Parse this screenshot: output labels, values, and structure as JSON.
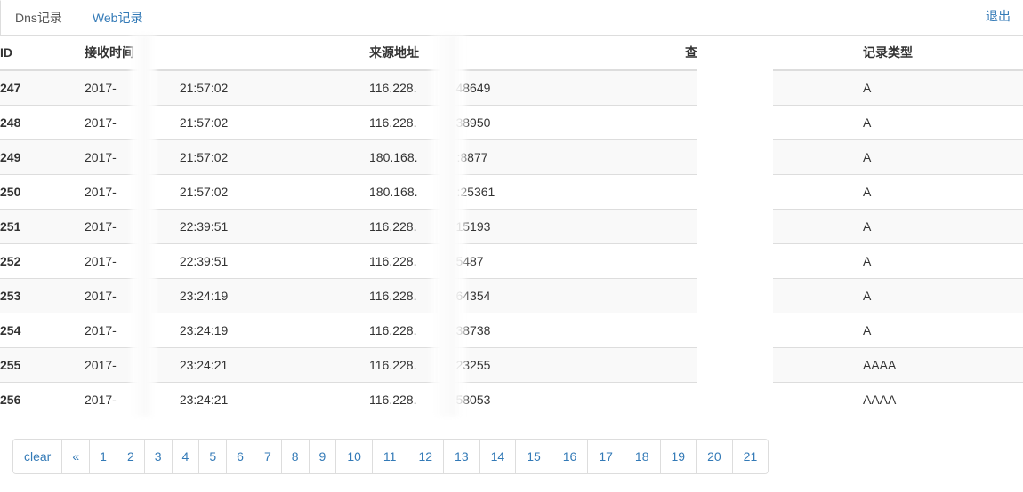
{
  "header": {
    "tabs": [
      {
        "label": "Dns记录",
        "active": true,
        "name": "tab-dns-records"
      },
      {
        "label": "Web记录",
        "active": false,
        "name": "tab-web-records"
      }
    ],
    "logout_label": "退出"
  },
  "table": {
    "columns": [
      {
        "key": "id",
        "label": "ID"
      },
      {
        "key": "time",
        "label": "接收时间"
      },
      {
        "key": "src",
        "label": "来源地址"
      },
      {
        "key": "host",
        "label": "查询主机"
      },
      {
        "key": "type",
        "label": "记录类型"
      }
    ],
    "rows": [
      {
        "id": "247",
        "date": "2017-",
        "time": "21:57:02",
        "ip": "116.228.",
        "port": "48649",
        "host": "",
        "type": "A"
      },
      {
        "id": "248",
        "date": "2017-",
        "time": "21:57:02",
        "ip": "116.228.",
        "port": "38950",
        "host": "",
        "type": "A"
      },
      {
        "id": "249",
        "date": "2017-",
        "time": "21:57:02",
        "ip": "180.168.",
        "port": ":8877",
        "host": "",
        "type": "A"
      },
      {
        "id": "250",
        "date": "2017-",
        "time": "21:57:02",
        "ip": "180.168.",
        "port": ":25361",
        "host": "",
        "type": "A"
      },
      {
        "id": "251",
        "date": "2017-",
        "time": "22:39:51",
        "ip": "116.228.",
        "port": "15193",
        "host": "",
        "type": "A"
      },
      {
        "id": "252",
        "date": "2017-",
        "time": "22:39:51",
        "ip": "116.228.",
        "port": "5487",
        "host": "",
        "type": "A"
      },
      {
        "id": "253",
        "date": "2017-",
        "time": "23:24:19",
        "ip": "116.228.",
        "port": "64354",
        "host": "",
        "type": "A"
      },
      {
        "id": "254",
        "date": "2017-",
        "time": "23:24:19",
        "ip": "116.228.",
        "port": "38738",
        "host": "",
        "type": "A"
      },
      {
        "id": "255",
        "date": "2017-",
        "time": "23:24:21",
        "ip": "116.228.",
        "port": "23255",
        "host": "",
        "type": "AAAA"
      },
      {
        "id": "256",
        "date": "2017-",
        "time": "23:24:21",
        "ip": "116.228.",
        "port": "58053",
        "host": "",
        "type": "AAAA"
      }
    ]
  },
  "pagination": {
    "items": [
      {
        "label": "clear",
        "name": "pagination-clear"
      },
      {
        "label": "«",
        "name": "pagination-prev"
      },
      {
        "label": "1",
        "name": "pagination-page-1"
      },
      {
        "label": "2",
        "name": "pagination-page-2"
      },
      {
        "label": "3",
        "name": "pagination-page-3"
      },
      {
        "label": "4",
        "name": "pagination-page-4"
      },
      {
        "label": "5",
        "name": "pagination-page-5"
      },
      {
        "label": "6",
        "name": "pagination-page-6"
      },
      {
        "label": "7",
        "name": "pagination-page-7"
      },
      {
        "label": "8",
        "name": "pagination-page-8"
      },
      {
        "label": "9",
        "name": "pagination-page-9"
      },
      {
        "label": "10",
        "name": "pagination-page-10"
      },
      {
        "label": "11",
        "name": "pagination-page-11"
      },
      {
        "label": "12",
        "name": "pagination-page-12"
      },
      {
        "label": "13",
        "name": "pagination-page-13"
      },
      {
        "label": "14",
        "name": "pagination-page-14"
      },
      {
        "label": "15",
        "name": "pagination-page-15"
      },
      {
        "label": "16",
        "name": "pagination-page-16"
      },
      {
        "label": "17",
        "name": "pagination-page-17"
      },
      {
        "label": "18",
        "name": "pagination-page-18"
      },
      {
        "label": "19",
        "name": "pagination-page-19"
      },
      {
        "label": "20",
        "name": "pagination-page-20"
      },
      {
        "label": "21",
        "name": "pagination-page-21"
      }
    ]
  },
  "colors": {
    "link": "#337ab7",
    "text": "#333333",
    "border": "#dddddd",
    "stripe": "#f9f9f9"
  }
}
